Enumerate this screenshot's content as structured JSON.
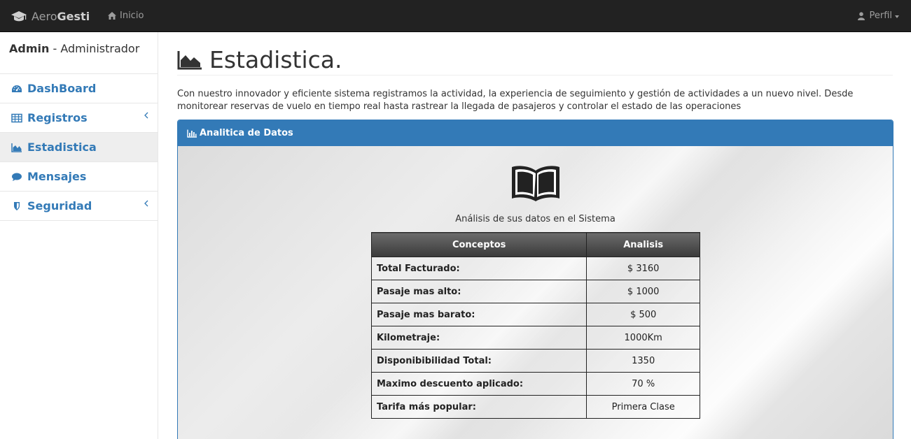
{
  "navbar": {
    "brand_light": "Aero",
    "brand_bold": "Gesti",
    "home_label": "Inicio",
    "profile_label": "Perfil"
  },
  "sidebar": {
    "user_name": "Admin",
    "user_role": " - Administrador",
    "items": [
      {
        "label": "DashBoard",
        "icon": "dashboard-icon"
      },
      {
        "label": "Registros",
        "icon": "table-icon",
        "expandable": true
      },
      {
        "label": "Estadistica",
        "icon": "area-chart-icon",
        "active": true
      },
      {
        "label": "Mensajes",
        "icon": "comment-icon"
      },
      {
        "label": "Seguridad",
        "icon": "shield-icon",
        "expandable": true
      }
    ]
  },
  "main": {
    "title": "Estadistica.",
    "intro": "Con nuestro innovador y eficiente sistema registramos la actividad, la experiencia de seguimiento y gestión de actividades a un nuevo nivel. Desde monitorear reservas de vuelo en tiempo real hasta rastrear la llegada de pasajeros y controlar el estado de las operaciones",
    "panel": {
      "heading": "Analitica de Datos",
      "caption": "Análisis de sus datos en el Sistema",
      "table": {
        "headers": [
          "Conceptos",
          "Analisis"
        ],
        "rows": [
          {
            "concept": "Total Facturado:",
            "value": "$ 3160"
          },
          {
            "concept": "Pasaje mas alto:",
            "value": "$ 1000"
          },
          {
            "concept": "Pasaje mas barato:",
            "value": "$ 500"
          },
          {
            "concept": "Kilometraje:",
            "value": "1000Km"
          },
          {
            "concept": "Disponibibilidad Total:",
            "value": "1350"
          },
          {
            "concept": "Maximo descuento aplicado:",
            "value": "70 %"
          },
          {
            "concept": "Tarifa más popular:",
            "value": "Primera Clase"
          }
        ]
      }
    }
  },
  "colors": {
    "navbar_bg": "#222222",
    "accent": "#337ab7",
    "active_item_bg": "#eeeeee"
  }
}
